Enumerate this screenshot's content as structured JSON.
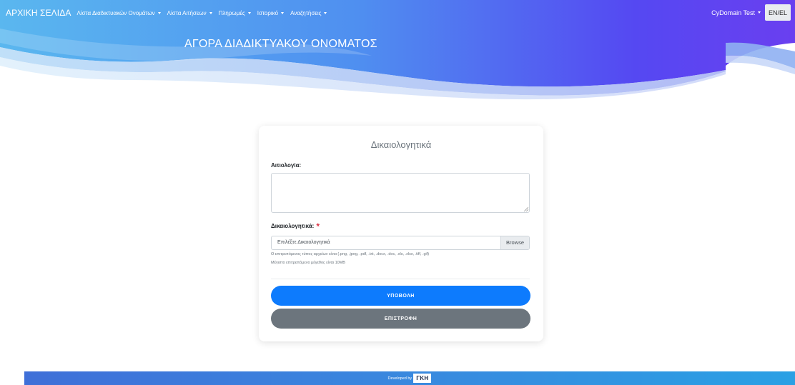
{
  "navbar": {
    "brand": "ΑΡΧΙΚΗ ΣΕΛΙΔΑ",
    "items": [
      {
        "label": "Λίστα Διαδικτυακών Ονομάτων"
      },
      {
        "label": "Λίστα Αιτήσεων"
      },
      {
        "label": "Πληρωμές"
      },
      {
        "label": "Ιστορικό"
      },
      {
        "label": "Αναζητήσεις"
      }
    ],
    "user": "CyDomain Test",
    "lang": "EN/EL"
  },
  "page": {
    "title": "ΑΓΟΡΑ ΔΙΑΔΙΚΤΥΑΚΟΥ ΟΝΟΜΑΤΟΣ"
  },
  "form": {
    "title": "Δικαιολογητικά",
    "justification_label": "Αιτιολογία:",
    "justification_value": "",
    "documents_label": "Δικαιολογητικά:",
    "required_mark": "*",
    "file_placeholder": "Επιλέξτε Δικαιολογητικά",
    "browse_label": "Browse",
    "help_types": "Ο επιτρεπόμενος τύπος αρχείων είναι (.png, .jpeg, .pdf, .txt, .docx, .doc, .xls, .xlsx, .tiff, .gif)",
    "help_size": "Μέγιστο επιτρεπόμενο μέγεθος είναι 10MB",
    "submit_label": "ΥΠΟΒΟΛΗ",
    "back_label": "ΕΠΙΣΤΡΟΦΗ"
  },
  "footer": {
    "developed_by": "Developed by",
    "logo_text": "ΓΚΗ"
  },
  "colors": {
    "primary": "#0d7bfd",
    "secondary": "#6c757d",
    "hero_start": "#5ab4ef",
    "hero_end": "#5b3ff2",
    "required": "#dc3545"
  }
}
